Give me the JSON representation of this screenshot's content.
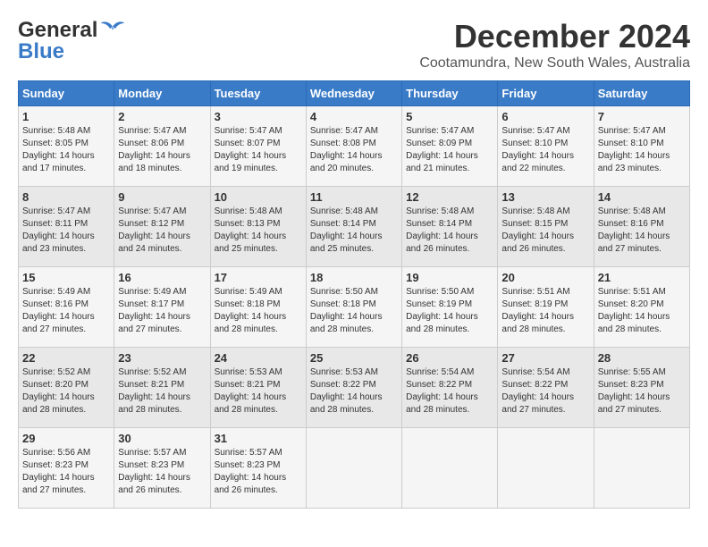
{
  "header": {
    "logo_general": "General",
    "logo_blue": "Blue",
    "month_title": "December 2024",
    "subtitle": "Cootamundra, New South Wales, Australia"
  },
  "days_of_week": [
    "Sunday",
    "Monday",
    "Tuesday",
    "Wednesday",
    "Thursday",
    "Friday",
    "Saturday"
  ],
  "weeks": [
    [
      {
        "day": "1",
        "sunrise": "Sunrise: 5:48 AM",
        "sunset": "Sunset: 8:05 PM",
        "daylight": "Daylight: 14 hours and 17 minutes."
      },
      {
        "day": "2",
        "sunrise": "Sunrise: 5:47 AM",
        "sunset": "Sunset: 8:06 PM",
        "daylight": "Daylight: 14 hours and 18 minutes."
      },
      {
        "day": "3",
        "sunrise": "Sunrise: 5:47 AM",
        "sunset": "Sunset: 8:07 PM",
        "daylight": "Daylight: 14 hours and 19 minutes."
      },
      {
        "day": "4",
        "sunrise": "Sunrise: 5:47 AM",
        "sunset": "Sunset: 8:08 PM",
        "daylight": "Daylight: 14 hours and 20 minutes."
      },
      {
        "day": "5",
        "sunrise": "Sunrise: 5:47 AM",
        "sunset": "Sunset: 8:09 PM",
        "daylight": "Daylight: 14 hours and 21 minutes."
      },
      {
        "day": "6",
        "sunrise": "Sunrise: 5:47 AM",
        "sunset": "Sunset: 8:10 PM",
        "daylight": "Daylight: 14 hours and 22 minutes."
      },
      {
        "day": "7",
        "sunrise": "Sunrise: 5:47 AM",
        "sunset": "Sunset: 8:10 PM",
        "daylight": "Daylight: 14 hours and 23 minutes."
      }
    ],
    [
      {
        "day": "8",
        "sunrise": "Sunrise: 5:47 AM",
        "sunset": "Sunset: 8:11 PM",
        "daylight": "Daylight: 14 hours and 23 minutes."
      },
      {
        "day": "9",
        "sunrise": "Sunrise: 5:47 AM",
        "sunset": "Sunset: 8:12 PM",
        "daylight": "Daylight: 14 hours and 24 minutes."
      },
      {
        "day": "10",
        "sunrise": "Sunrise: 5:48 AM",
        "sunset": "Sunset: 8:13 PM",
        "daylight": "Daylight: 14 hours and 25 minutes."
      },
      {
        "day": "11",
        "sunrise": "Sunrise: 5:48 AM",
        "sunset": "Sunset: 8:14 PM",
        "daylight": "Daylight: 14 hours and 25 minutes."
      },
      {
        "day": "12",
        "sunrise": "Sunrise: 5:48 AM",
        "sunset": "Sunset: 8:14 PM",
        "daylight": "Daylight: 14 hours and 26 minutes."
      },
      {
        "day": "13",
        "sunrise": "Sunrise: 5:48 AM",
        "sunset": "Sunset: 8:15 PM",
        "daylight": "Daylight: 14 hours and 26 minutes."
      },
      {
        "day": "14",
        "sunrise": "Sunrise: 5:48 AM",
        "sunset": "Sunset: 8:16 PM",
        "daylight": "Daylight: 14 hours and 27 minutes."
      }
    ],
    [
      {
        "day": "15",
        "sunrise": "Sunrise: 5:49 AM",
        "sunset": "Sunset: 8:16 PM",
        "daylight": "Daylight: 14 hours and 27 minutes."
      },
      {
        "day": "16",
        "sunrise": "Sunrise: 5:49 AM",
        "sunset": "Sunset: 8:17 PM",
        "daylight": "Daylight: 14 hours and 27 minutes."
      },
      {
        "day": "17",
        "sunrise": "Sunrise: 5:49 AM",
        "sunset": "Sunset: 8:18 PM",
        "daylight": "Daylight: 14 hours and 28 minutes."
      },
      {
        "day": "18",
        "sunrise": "Sunrise: 5:50 AM",
        "sunset": "Sunset: 8:18 PM",
        "daylight": "Daylight: 14 hours and 28 minutes."
      },
      {
        "day": "19",
        "sunrise": "Sunrise: 5:50 AM",
        "sunset": "Sunset: 8:19 PM",
        "daylight": "Daylight: 14 hours and 28 minutes."
      },
      {
        "day": "20",
        "sunrise": "Sunrise: 5:51 AM",
        "sunset": "Sunset: 8:19 PM",
        "daylight": "Daylight: 14 hours and 28 minutes."
      },
      {
        "day": "21",
        "sunrise": "Sunrise: 5:51 AM",
        "sunset": "Sunset: 8:20 PM",
        "daylight": "Daylight: 14 hours and 28 minutes."
      }
    ],
    [
      {
        "day": "22",
        "sunrise": "Sunrise: 5:52 AM",
        "sunset": "Sunset: 8:20 PM",
        "daylight": "Daylight: 14 hours and 28 minutes."
      },
      {
        "day": "23",
        "sunrise": "Sunrise: 5:52 AM",
        "sunset": "Sunset: 8:21 PM",
        "daylight": "Daylight: 14 hours and 28 minutes."
      },
      {
        "day": "24",
        "sunrise": "Sunrise: 5:53 AM",
        "sunset": "Sunset: 8:21 PM",
        "daylight": "Daylight: 14 hours and 28 minutes."
      },
      {
        "day": "25",
        "sunrise": "Sunrise: 5:53 AM",
        "sunset": "Sunset: 8:22 PM",
        "daylight": "Daylight: 14 hours and 28 minutes."
      },
      {
        "day": "26",
        "sunrise": "Sunrise: 5:54 AM",
        "sunset": "Sunset: 8:22 PM",
        "daylight": "Daylight: 14 hours and 28 minutes."
      },
      {
        "day": "27",
        "sunrise": "Sunrise: 5:54 AM",
        "sunset": "Sunset: 8:22 PM",
        "daylight": "Daylight: 14 hours and 27 minutes."
      },
      {
        "day": "28",
        "sunrise": "Sunrise: 5:55 AM",
        "sunset": "Sunset: 8:23 PM",
        "daylight": "Daylight: 14 hours and 27 minutes."
      }
    ],
    [
      {
        "day": "29",
        "sunrise": "Sunrise: 5:56 AM",
        "sunset": "Sunset: 8:23 PM",
        "daylight": "Daylight: 14 hours and 27 minutes."
      },
      {
        "day": "30",
        "sunrise": "Sunrise: 5:57 AM",
        "sunset": "Sunset: 8:23 PM",
        "daylight": "Daylight: 14 hours and 26 minutes."
      },
      {
        "day": "31",
        "sunrise": "Sunrise: 5:57 AM",
        "sunset": "Sunset: 8:23 PM",
        "daylight": "Daylight: 14 hours and 26 minutes."
      },
      null,
      null,
      null,
      null
    ]
  ]
}
